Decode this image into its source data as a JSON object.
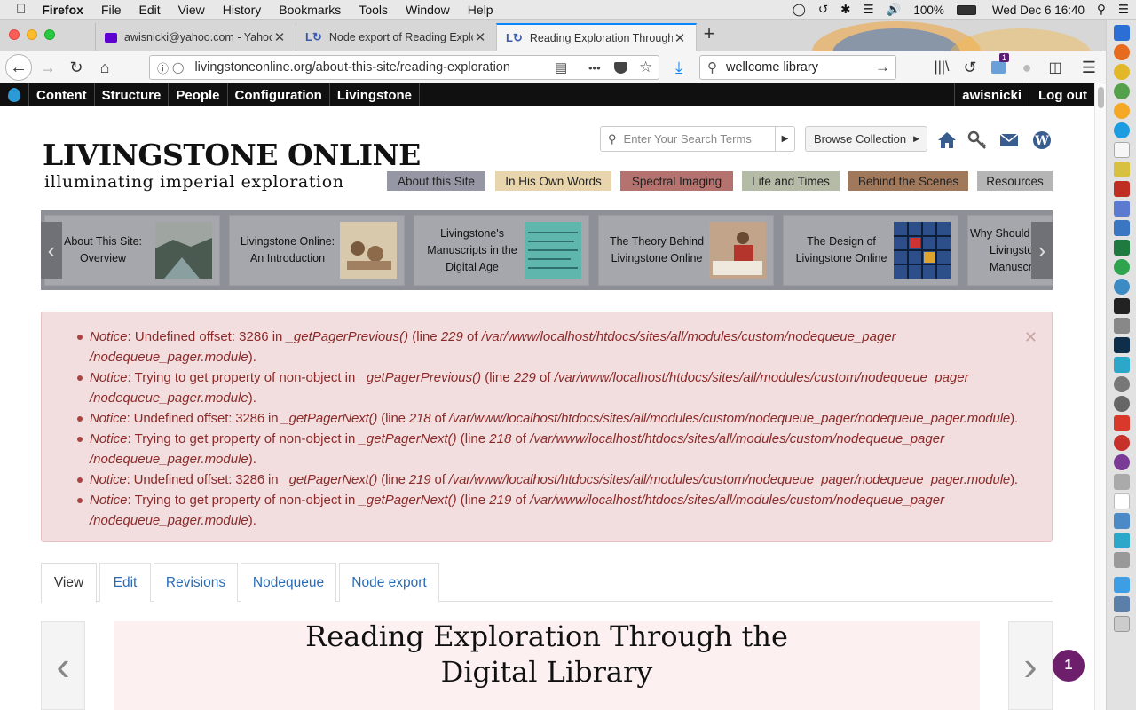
{
  "menubar": {
    "app": "Firefox",
    "items": [
      "File",
      "Edit",
      "View",
      "History",
      "Bookmarks",
      "Tools",
      "Window",
      "Help"
    ],
    "battery": "100%",
    "datetime": "Wed Dec 6  16:40"
  },
  "browser": {
    "tabs": [
      {
        "title": "awisnicki@yahoo.com - Yahoo Mail",
        "active": false
      },
      {
        "title": "Node export of Reading Exploration",
        "active": false
      },
      {
        "title": "Reading Exploration Through the Digital Library",
        "active": true
      }
    ],
    "url": "livingstoneonline.org/about-this-site/reading-exploration",
    "search_value": "wellcome library",
    "more_label": "•••",
    "notification_count": "1"
  },
  "admin": {
    "items": [
      "Content",
      "Structure",
      "People",
      "Configuration",
      "Livingstone"
    ],
    "user": "awisnicki",
    "logout": "Log out"
  },
  "site": {
    "title": "LIVINGSTONE ONLINE",
    "subtitle": "illuminating imperial exploration",
    "search_placeholder": "Enter Your Search Terms",
    "browse_label": "Browse Collection",
    "nav": [
      {
        "label": "About this Site",
        "color": "#9597a5"
      },
      {
        "label": "In His Own Words",
        "color": "#e8d5ae"
      },
      {
        "label": "Spectral Imaging",
        "color": "#b5736f"
      },
      {
        "label": "Life and Times",
        "color": "#b4bba6"
      },
      {
        "label": "Behind the Scenes",
        "color": "#a0795c"
      },
      {
        "label": "Resources",
        "color": "#b5b5b5"
      }
    ]
  },
  "carousel": {
    "cards": [
      {
        "lines": [
          "About This Site:",
          "Overview"
        ]
      },
      {
        "lines": [
          "Livingstone Online:",
          "An Introduction"
        ]
      },
      {
        "lines": [
          "Livingstone's",
          "Manuscripts in the",
          "Digital Age"
        ]
      },
      {
        "lines": [
          "The Theory Behind",
          "Livingstone Online"
        ]
      },
      {
        "lines": [
          "The Design of",
          "Livingstone Online"
        ]
      },
      {
        "lines": [
          "Why Should We Read",
          "Livingstone's",
          "Manuscripts?"
        ]
      }
    ]
  },
  "notices": [
    {
      "label": "Notice",
      "msg": ": Undefined offset: 3286 in ",
      "fn": "_getPagerPrevious()",
      "line_pre": " (line ",
      "line": "229",
      "of": " of ",
      "path": "/var/www/localhost/htdocs/sites/all/modules/custom/nodequeue_pager /nodequeue_pager.module",
      "end": ")."
    },
    {
      "label": "Notice",
      "msg": ": Trying to get property of non-object in ",
      "fn": "_getPagerPrevious()",
      "line_pre": " (line ",
      "line": "229",
      "of": " of ",
      "path": "/var/www/localhost/htdocs/sites/all/modules/custom/nodequeue_pager /nodequeue_pager.module",
      "end": ")."
    },
    {
      "label": "Notice",
      "msg": ": Undefined offset: 3286 in ",
      "fn": "_getPagerNext()",
      "line_pre": " (line ",
      "line": "218",
      "of": " of ",
      "path": "/var/www/localhost/htdocs/sites/all/modules/custom/nodequeue_pager/nodequeue_pager.module",
      "end": ")."
    },
    {
      "label": "Notice",
      "msg": ": Trying to get property of non-object in ",
      "fn": "_getPagerNext()",
      "line_pre": " (line ",
      "line": "218",
      "of": " of ",
      "path": "/var/www/localhost/htdocs/sites/all/modules/custom/nodequeue_pager /nodequeue_pager.module",
      "end": ")."
    },
    {
      "label": "Notice",
      "msg": ": Undefined offset: 3286 in ",
      "fn": "_getPagerNext()",
      "line_pre": " (line ",
      "line": "219",
      "of": " of ",
      "path": "/var/www/localhost/htdocs/sites/all/modules/custom/nodequeue_pager/nodequeue_pager.module",
      "end": ")."
    },
    {
      "label": "Notice",
      "msg": ": Trying to get property of non-object in ",
      "fn": "_getPagerNext()",
      "line_pre": " (line ",
      "line": "219",
      "of": " of ",
      "path": "/var/www/localhost/htdocs/sites/all/modules/custom/nodequeue_pager /nodequeue_pager.module",
      "end": ")."
    }
  ],
  "page_tabs": [
    {
      "label": "View",
      "active": true
    },
    {
      "label": "Edit",
      "active": false
    },
    {
      "label": "Revisions",
      "active": false
    },
    {
      "label": "Nodequeue",
      "active": false
    },
    {
      "label": "Node export",
      "active": false
    }
  ],
  "content": {
    "title": "Reading Exploration Through the Digital Library",
    "badge_count": "1"
  },
  "colors": {
    "accent": "#0a84ff",
    "notice_bg": "#f2dede",
    "notice_text": "#8b2a2a",
    "link": "#2a6bb5",
    "badge": "#6d1f6c"
  }
}
